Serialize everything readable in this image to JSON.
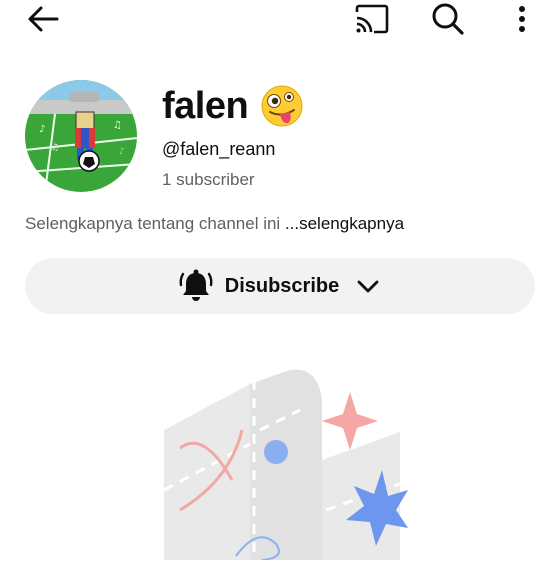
{
  "channel": {
    "name": "falen",
    "emoji": "crazy-face-emoji",
    "handle": "@falen_reann",
    "subscribers": "1 subscriber",
    "about_text": "Selengkapnya tentang channel ini ",
    "about_more": "...selengkapnya"
  },
  "subscribe_button": {
    "label": "Disubscribe"
  },
  "topbar": {
    "icons": [
      "back-arrow-icon",
      "cast-icon",
      "search-icon",
      "more-vert-icon"
    ]
  },
  "colors": {
    "button_bg": "#f2f2f2",
    "secondary_text": "#606060"
  }
}
